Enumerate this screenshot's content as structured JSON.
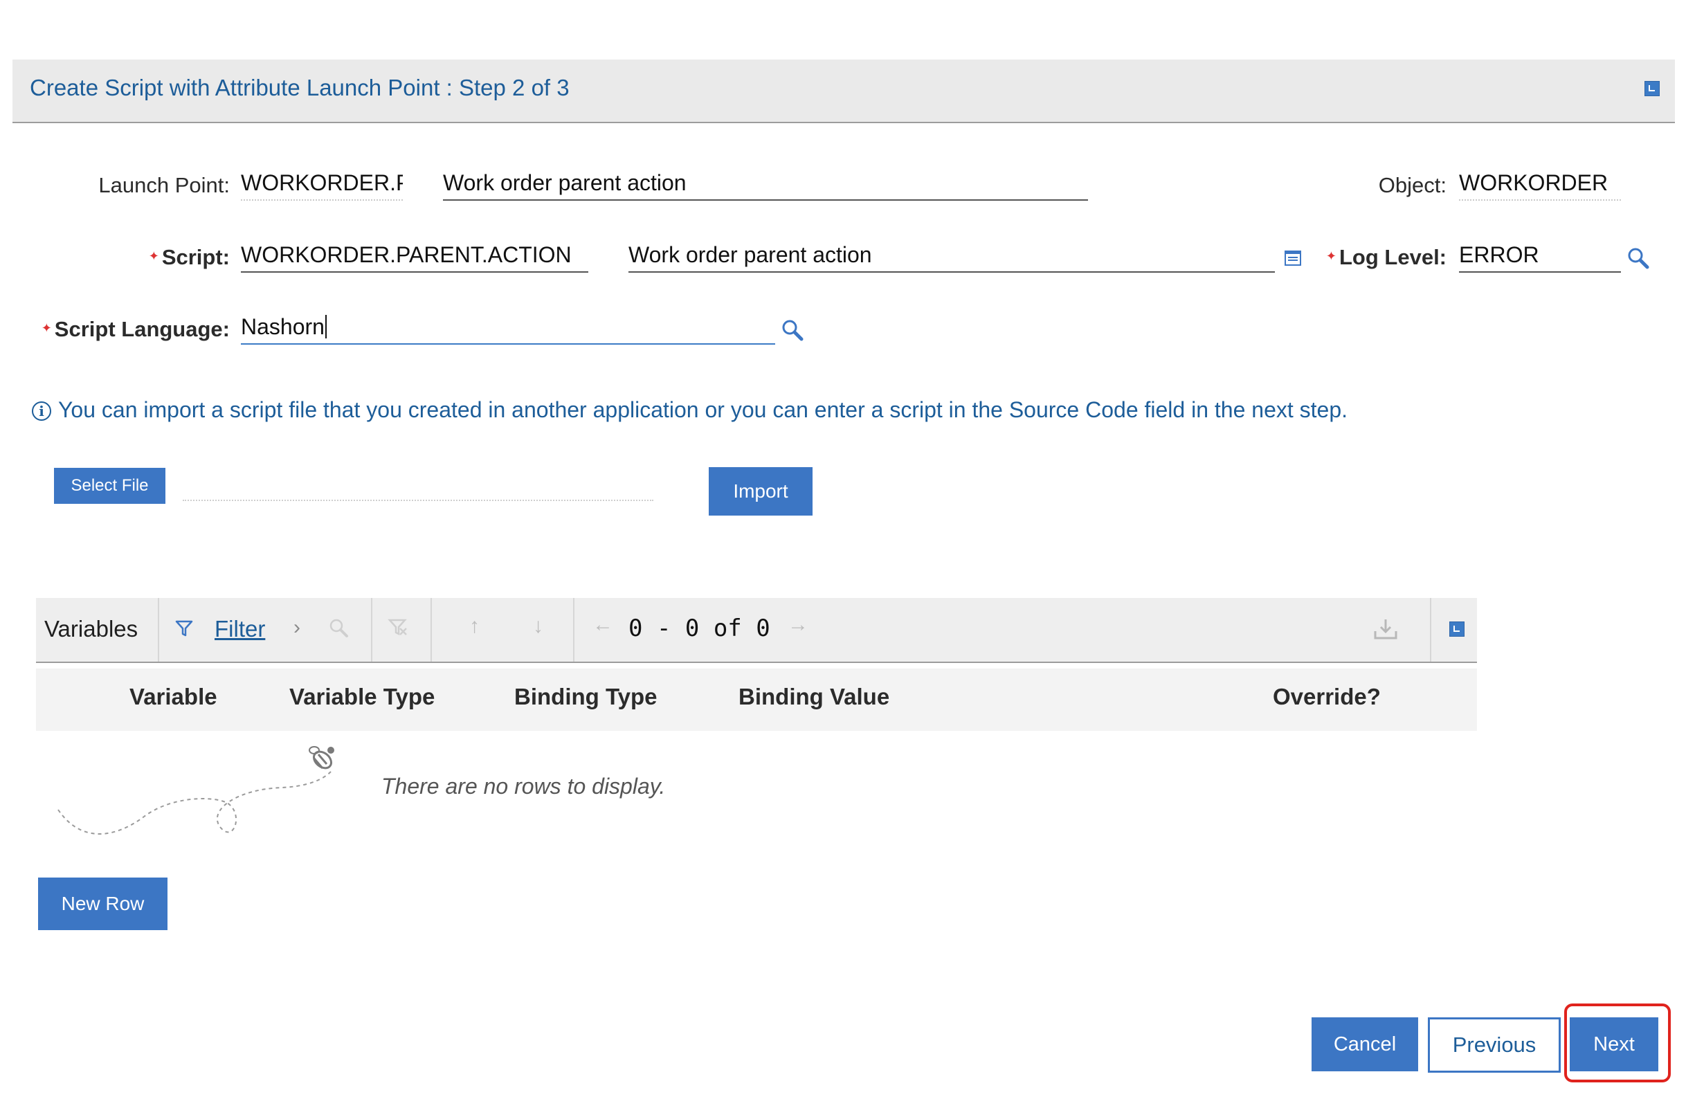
{
  "dialog": {
    "title": "Create Script with Attribute Launch Point : Step 2 of 3",
    "minimize_icon": "minimize-icon"
  },
  "form": {
    "launch_point": {
      "label": "Launch Point:",
      "value": "WORKORDER.PA",
      "description": "Work order parent action"
    },
    "object": {
      "label": "Object:",
      "value": "WORKORDER"
    },
    "script": {
      "label": "Script:",
      "value": "WORKORDER.PARENT.ACTION",
      "description": "Work order parent action",
      "required": true
    },
    "log_level": {
      "label": "Log Level:",
      "value": "ERROR",
      "required": true
    },
    "script_language": {
      "label": "Script Language:",
      "value": "Nashorn",
      "required": true
    }
  },
  "info": {
    "icon": "info-icon",
    "message": "You can import a script file that you created in another application or you can enter a script in the Source Code field in the next step."
  },
  "import": {
    "select_file_label": "Select File",
    "import_label": "Import"
  },
  "variables_table": {
    "title": "Variables",
    "filter_label": "Filter",
    "pager": "0 - 0 of 0",
    "columns": [
      "Variable",
      "Variable Type",
      "Binding Type",
      "Binding Value",
      "Override?"
    ],
    "rows": [],
    "empty_message": "There are no rows to display.",
    "new_row_label": "New Row"
  },
  "footer": {
    "cancel_label": "Cancel",
    "previous_label": "Previous",
    "next_label": "Next"
  },
  "colors": {
    "accent": "#3c76c4",
    "title_blue": "#1d5d99",
    "highlight": "#e0231d"
  }
}
